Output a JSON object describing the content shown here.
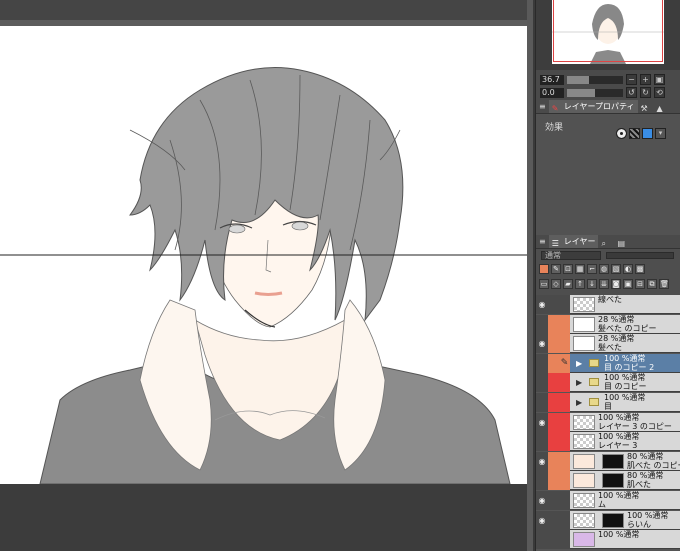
{
  "navigator": {
    "zoom_value": "36.7",
    "rotate_value": "0.0"
  },
  "layer_property_panel": {
    "tab_label": "レイヤープロパティ",
    "effect_label": "効果"
  },
  "layer_panel": {
    "tab_label": "レイヤー",
    "blend_mode": "通常",
    "layers": [
      {
        "line1": "線べた",
        "line2": "",
        "eye": true,
        "tag_color": "#4a4a4a",
        "thumb": "check",
        "indent": 0
      },
      {
        "line1": "28 %通常",
        "line2": "髪べた のコピー",
        "eye": false,
        "tag_color": "#e8835a",
        "thumb": "white",
        "indent": 0
      },
      {
        "line1": "28 %通常",
        "line2": "髪べた",
        "eye": true,
        "tag_color": "#e8835a",
        "thumb": "white",
        "indent": 0
      },
      {
        "line1": "100 %通常",
        "line2": "目 のコピー 2",
        "eye": false,
        "tag_color": "#e8835a",
        "thumb": "folder",
        "indent": 1,
        "selected": true
      },
      {
        "line1": "100 %通常",
        "line2": "目 のコピー",
        "eye": false,
        "tag_color": "#e84040",
        "thumb": "folder",
        "indent": 1
      },
      {
        "line1": "100 %通常",
        "line2": "目",
        "eye": false,
        "tag_color": "#e84040",
        "thumb": "folder",
        "indent": 1
      },
      {
        "line1": "100 %通常",
        "line2": "レイヤー 3 のコピー",
        "eye": true,
        "tag_color": "#e84040",
        "thumb": "check",
        "indent": 0
      },
      {
        "line1": "100 %通常",
        "line2": "レイヤー 3",
        "eye": false,
        "tag_color": "#e84040",
        "thumb": "check",
        "indent": 0
      },
      {
        "line1": "80 %通常",
        "line2": "肌べた のコピー",
        "eye": true,
        "tag_color": "#e8835a",
        "thumb": "skin",
        "indent": 0,
        "mask": true
      },
      {
        "line1": "80 %通常",
        "line2": "肌べた",
        "eye": false,
        "tag_color": "#e8835a",
        "thumb": "skin",
        "indent": 0,
        "mask": true
      },
      {
        "line1": "100 %通常",
        "line2": "ム",
        "eye": true,
        "tag_color": "#4a4a4a",
        "thumb": "check",
        "indent": 0
      },
      {
        "line1": "100 %通常",
        "line2": "らいん",
        "eye": true,
        "tag_color": "#4a4a4a",
        "thumb": "check",
        "indent": 0,
        "mask": true
      },
      {
        "line1": "100 %通常",
        "line2": "",
        "eye": false,
        "tag_color": "#4a4a4a",
        "thumb": "purple",
        "indent": 0
      }
    ]
  }
}
